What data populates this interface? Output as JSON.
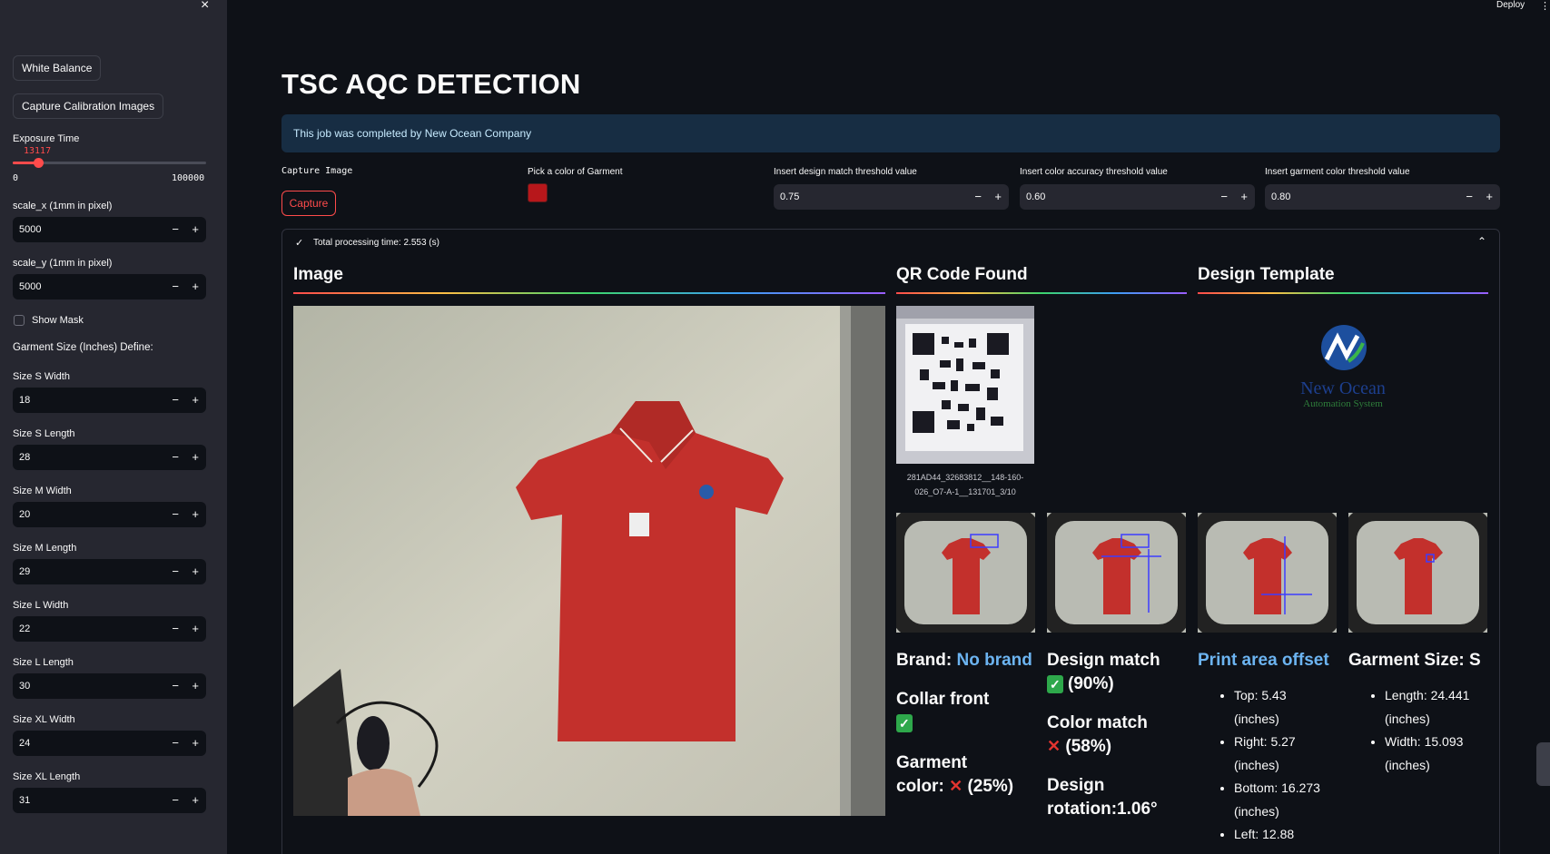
{
  "sidebar": {
    "white_balance": "White Balance",
    "capture_calibration": "Capture Calibration Images",
    "exposure": {
      "label": "Exposure Time",
      "value": 13117,
      "value_text": "13117",
      "min": "0",
      "max": "100000"
    },
    "scale_x": {
      "label": "scale_x (1mm in pixel)",
      "value": "5000"
    },
    "scale_y": {
      "label": "scale_y (1mm in pixel)",
      "value": "5000"
    },
    "show_mask": "Show Mask",
    "garment_heading": "Garment Size (Inches) Define:",
    "sizes": [
      {
        "label": "Size S Width",
        "value": "18"
      },
      {
        "label": "Size S Length",
        "value": "28"
      },
      {
        "label": "Size M Width",
        "value": "20"
      },
      {
        "label": "Size M Length",
        "value": "29"
      },
      {
        "label": "Size L Width",
        "value": "22"
      },
      {
        "label": "Size L Length",
        "value": "30"
      },
      {
        "label": "Size XL Width",
        "value": "24"
      },
      {
        "label": "Size XL Length",
        "value": "31"
      }
    ],
    "minus": "−",
    "plus": "+",
    "close": "×"
  },
  "header": {
    "deploy": "Deploy",
    "menu": "⋮"
  },
  "main": {
    "title": "TSC AQC DETECTION",
    "info": "This job was completed by New Ocean Company",
    "capture_label": "Capture Image",
    "capture_button": "Capture",
    "color_label": "Pick a color of Garment",
    "garment_color": "#b7171b",
    "thresholds": [
      {
        "label": "Insert design match threshold value",
        "value": "0.75"
      },
      {
        "label": "Insert color accuracy threshold value",
        "value": "0.60"
      },
      {
        "label": "Insert garment color threshold value",
        "value": "0.80"
      }
    ],
    "expander": {
      "check": "✓",
      "label": "Total processing time: 2.553 (s)",
      "chevron": "⌃"
    },
    "sections": {
      "image": "Image",
      "qr": "QR Code Found",
      "design": "Design Template"
    },
    "qr_caption_1": "281AD44_32683812__148-160-",
    "qr_caption_2": "026_O7-A-1__131701_3/10",
    "logo": {
      "name": "New Ocean",
      "tagline": "Automation System"
    },
    "results": {
      "brand_label": "Brand: ",
      "brand_value": "No brand",
      "collar": "Collar front",
      "garment_color_1": "Garment",
      "garment_color_2": "color:",
      "garment_color_pct": "(25%)",
      "design_match": "Design match",
      "design_match_pct": "(90%)",
      "color_match": "Color match",
      "color_match_pct": "(58%)",
      "rotation_1": "Design",
      "rotation_2": "rotation:1.06°",
      "print_offset": "Print area offset",
      "offsets": [
        {
          "line1": "Top: 5.43",
          "line2": "(inches)"
        },
        {
          "line1": "Right: 5.27",
          "line2": "(inches)"
        },
        {
          "line1": "Bottom: 16.273",
          "line2": "(inches)"
        },
        {
          "line1": "Left: 12.88",
          "line2": ""
        }
      ],
      "garment_size": "Garment Size: S",
      "size_items": [
        {
          "line1": "Length: 24.441",
          "line2": "(inches)"
        },
        {
          "line1": "Width: 15.093",
          "line2": "(inches)"
        }
      ],
      "check_icon": "✓",
      "cross_icon": "✕"
    }
  }
}
